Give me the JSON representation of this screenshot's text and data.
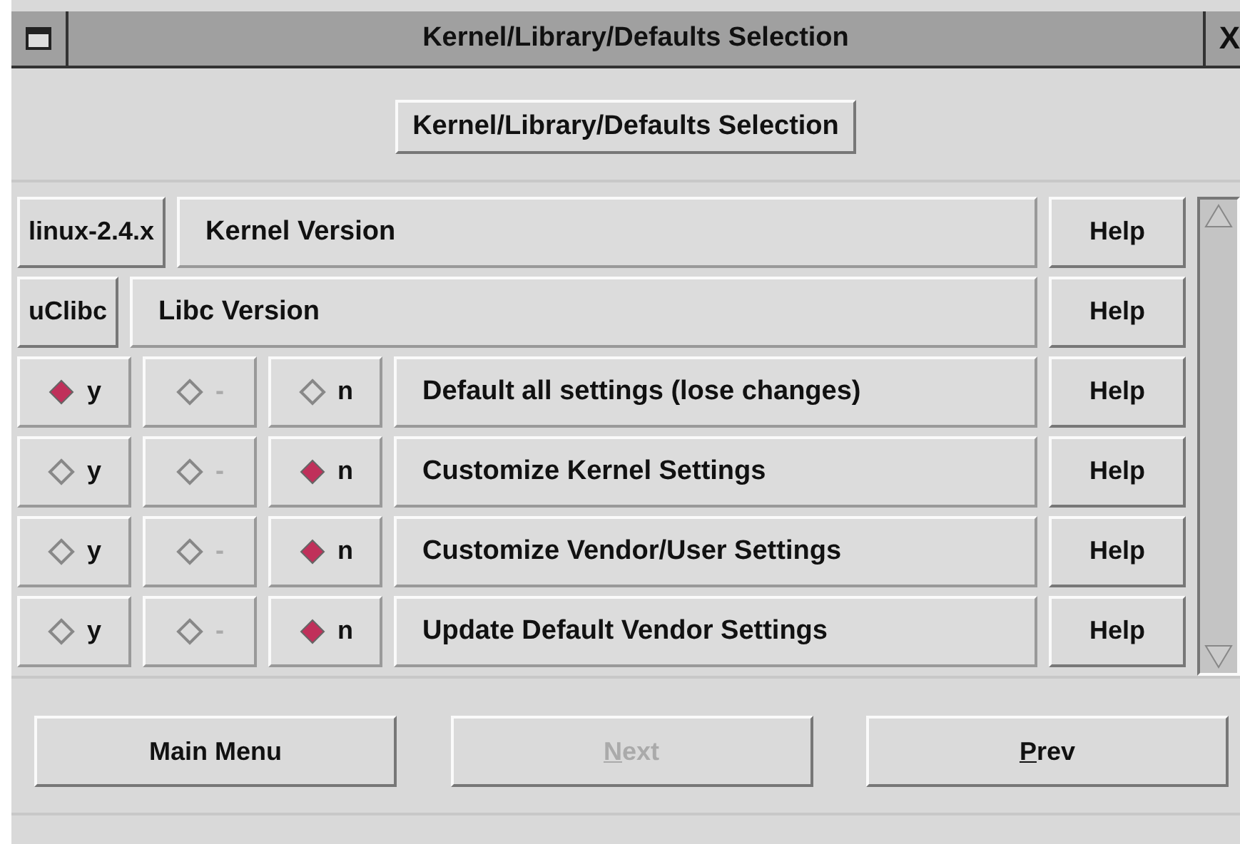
{
  "window": {
    "title": "Kernel/Library/Defaults Selection",
    "close": "X"
  },
  "heading": "Kernel/Library/Defaults Selection",
  "rows": [
    {
      "kind": "choice",
      "value": "linux-2.4.x",
      "label": "Kernel Version",
      "help": "Help"
    },
    {
      "kind": "choice",
      "value": "uClibc",
      "label": "Libc Version",
      "help": "Help"
    },
    {
      "kind": "tristate",
      "options": [
        {
          "label": "y",
          "selected": true,
          "disabled": false
        },
        {
          "label": "-",
          "selected": false,
          "disabled": true
        },
        {
          "label": "n",
          "selected": false,
          "disabled": false
        }
      ],
      "label": "Default all settings (lose changes)",
      "help": "Help"
    },
    {
      "kind": "tristate",
      "options": [
        {
          "label": "y",
          "selected": false,
          "disabled": false
        },
        {
          "label": "-",
          "selected": false,
          "disabled": true
        },
        {
          "label": "n",
          "selected": true,
          "disabled": false
        }
      ],
      "label": "Customize Kernel Settings",
      "help": "Help"
    },
    {
      "kind": "tristate",
      "options": [
        {
          "label": "y",
          "selected": false,
          "disabled": false
        },
        {
          "label": "-",
          "selected": false,
          "disabled": true
        },
        {
          "label": "n",
          "selected": true,
          "disabled": false
        }
      ],
      "label": "Customize Vendor/User Settings",
      "help": "Help"
    },
    {
      "kind": "tristate",
      "options": [
        {
          "label": "y",
          "selected": false,
          "disabled": false
        },
        {
          "label": "-",
          "selected": false,
          "disabled": true
        },
        {
          "label": "n",
          "selected": true,
          "disabled": false
        }
      ],
      "label": "Update Default Vendor Settings",
      "help": "Help"
    }
  ],
  "buttons": [
    {
      "rest": "Main Menu",
      "disabled": false
    },
    {
      "mnemonic": "N",
      "rest": "ext",
      "disabled": true
    },
    {
      "mnemonic": "P",
      "rest": "rev",
      "disabled": false
    }
  ]
}
